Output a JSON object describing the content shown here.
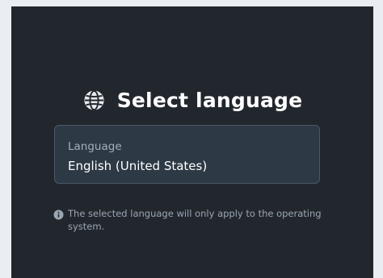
{
  "dialog": {
    "title": "Select language",
    "title_icon": "globe-icon",
    "language_select": {
      "label": "Language",
      "value": "English (United States)"
    },
    "note": {
      "icon": "info-icon",
      "text": "The selected language will only apply to the operating system."
    }
  },
  "colors": {
    "panel_background": "#22272e",
    "page_background": "#eaeef2",
    "select_background": "#2d3945",
    "select_border": "#4a5866",
    "title_text": "#ffffff",
    "muted_text": "#9aa6b2"
  }
}
